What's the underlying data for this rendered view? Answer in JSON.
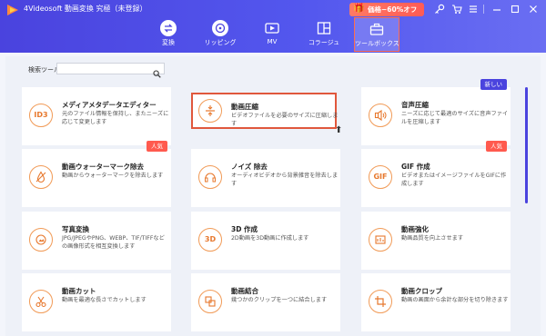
{
  "window": {
    "title": "4Videosoft 動画変換 究極（未登録）",
    "promo": "価格−60%オフ"
  },
  "nav": [
    {
      "label": "変換",
      "icon": "convert-icon"
    },
    {
      "label": "リッピング",
      "icon": "ripper-icon"
    },
    {
      "label": "MV",
      "icon": "mv-icon"
    },
    {
      "label": "コラージュ",
      "icon": "collage-icon"
    },
    {
      "label": "ツールボックス",
      "icon": "toolbox-icon",
      "active": true
    }
  ],
  "search": {
    "label": "検索ツール:",
    "value": "",
    "placeholder": ""
  },
  "tools": [
    {
      "title": "メディアメタデータエディター",
      "desc": "元のファイル情報を保持し、またニーズに応じて変更します",
      "icon": "ID3",
      "badge": ""
    },
    {
      "title": "動画圧縮",
      "desc": "ビデオファイルを必要のサイズに圧縮します",
      "icon": "compress-icon",
      "badge": "",
      "highlighted": true
    },
    {
      "title": "音声圧縮",
      "desc": "ニーズに応じて最適のサイズに音声ファイルを圧縮します",
      "icon": "audio-compress-icon",
      "badge": "新しい"
    },
    {
      "title": "動画ウォーターマーク除去",
      "desc": "動画からウォーターマークを除去します",
      "icon": "watermark-remove-icon",
      "badge": "人気"
    },
    {
      "title": "ノイズ 除去",
      "desc": "オーディオビデオから背景雑音を除去します",
      "icon": "noise-remove-icon",
      "badge": ""
    },
    {
      "title": "GIF 作成",
      "desc": "ビデオまたはイメージファイルをGIFに作成します",
      "icon": "GIF",
      "badge": "人気"
    },
    {
      "title": "写真変換",
      "desc": "JPG/JPEGやPNG、WEBP、TIF/TIFFなどの画像形式を相互変換します",
      "icon": "photo-convert-icon",
      "badge": ""
    },
    {
      "title": "3D 作成",
      "desc": "2D動画を3D動画に作成します",
      "icon": "3D",
      "badge": ""
    },
    {
      "title": "動画強化",
      "desc": "動画品質を向上させます",
      "icon": "enhance-icon",
      "badge": ""
    },
    {
      "title": "動画カット",
      "desc": "動画を最適な長さでカットします",
      "icon": "cut-icon",
      "badge": ""
    },
    {
      "title": "動画結合",
      "desc": "幾つかのクリップを一つに結合します",
      "icon": "merge-icon",
      "badge": ""
    },
    {
      "title": "動画クロップ",
      "desc": "動画の画面から余計な部分を切り除きます",
      "icon": "crop-icon",
      "badge": ""
    }
  ],
  "colors": {
    "primary": "#4a43de",
    "accent": "#e7782d",
    "badge_hot": "#ff5a4e",
    "highlight_border": "#e0573c"
  }
}
